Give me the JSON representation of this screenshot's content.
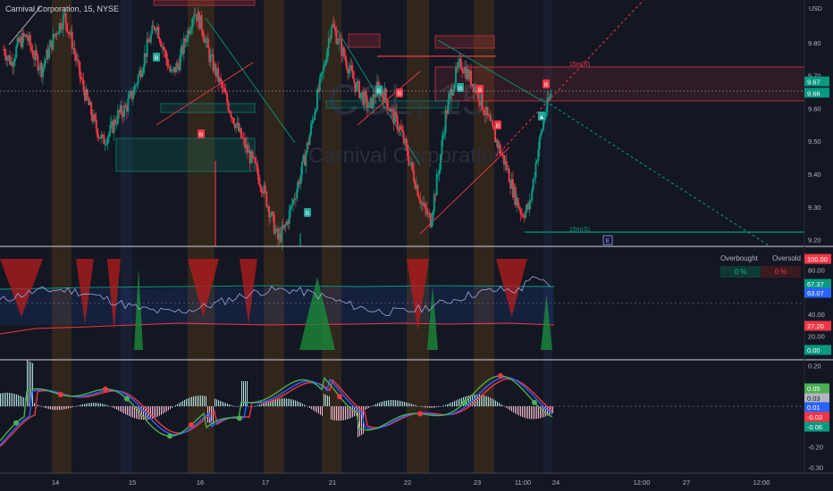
{
  "header": {
    "symbol_text": "Carnival Corporation, 15, NYSE"
  },
  "watermark": {
    "ticker": "CCL, 15",
    "name": "Carnival Corporation"
  },
  "price_axis": {
    "currency": "USD",
    "ticks": [
      "9.80",
      "9.70",
      "9.60",
      "9.50",
      "9.40",
      "9.30",
      "9.20"
    ],
    "tick_values": [
      9.8,
      9.7,
      9.6,
      9.5,
      9.4,
      9.3,
      9.2
    ],
    "tag_high": "9.67",
    "tag_high_value": 9.67,
    "tag_low": "9.66",
    "tag_low_value": 9.66
  },
  "time_axis": {
    "labels": [
      "14",
      "15",
      "16",
      "17",
      "21",
      "22",
      "23",
      "11:00",
      "24",
      "12:00",
      "27",
      "12:00"
    ]
  },
  "zones": {
    "resistance_label": "15m(R)",
    "support_label": "15m(S)",
    "e_marker": "E"
  },
  "signal_labels": {
    "buy": "B",
    "sell": "B",
    "up": "▲"
  },
  "rsi_panel": {
    "ticks": [
      "80.00",
      "60.00",
      "40.00",
      "20.00"
    ],
    "tick_values": [
      80,
      60,
      40,
      20
    ],
    "tags": [
      {
        "text": "100.00",
        "value": 100,
        "color": "#f23645"
      },
      {
        "text": "67.37",
        "value": 67.37,
        "color": "#089981"
      },
      {
        "text": "63.07",
        "value": 63.07,
        "color": "#2962ff"
      },
      {
        "text": "27.20",
        "value": 27.2,
        "color": "#f23645"
      },
      {
        "text": "0.00",
        "value": 0,
        "color": "#089981"
      }
    ],
    "overbought_label": "Overbought",
    "oversold_label": "Oversold",
    "overbought_value": "0 %",
    "oversold_value": "0 %"
  },
  "macd_panel": {
    "ticks": [
      "0.20",
      "-0.20",
      "-0.30"
    ],
    "tick_values": [
      0.2,
      -0.2,
      -0.3
    ],
    "tags": [
      {
        "text": "0.05",
        "value": 0.05,
        "color": "#4caf50"
      },
      {
        "text": "0.03",
        "value": 0.03,
        "color": "#b2b5be"
      },
      {
        "text": "0.01",
        "value": 0.01,
        "color": "#2962ff"
      },
      {
        "text": "-0.03",
        "value": -0.03,
        "color": "#f23645"
      },
      {
        "text": "-0.06",
        "value": -0.06,
        "color": "#089981"
      }
    ]
  },
  "colors": {
    "bg": "#131722",
    "up": "#089981",
    "down": "#f23645",
    "macd_line": "#4caf50",
    "signal_line": "#2962ff",
    "slow_line": "#f23645",
    "session_orange": "#3a2b1c",
    "session_blue": "#1a2238"
  },
  "chart_data": {
    "type": "candlestick",
    "title": "Carnival Corporation, 15, NYSE",
    "ylim": [
      9.18,
      9.93
    ],
    "close_path": [
      9.78,
      9.74,
      9.8,
      9.82,
      9.76,
      9.72,
      9.78,
      9.84,
      9.88,
      9.8,
      9.7,
      9.62,
      9.55,
      9.5,
      9.53,
      9.58,
      9.6,
      9.65,
      9.72,
      9.8,
      9.86,
      9.78,
      9.7,
      9.74,
      9.82,
      9.9,
      9.85,
      9.76,
      9.7,
      9.64,
      9.58,
      9.52,
      9.47,
      9.42,
      9.36,
      9.28,
      9.2,
      9.24,
      9.32,
      9.4,
      9.5,
      9.62,
      9.72,
      9.86,
      9.8,
      9.74,
      9.68,
      9.64,
      9.6,
      9.66,
      9.64,
      9.58,
      9.54,
      9.46,
      9.38,
      9.3,
      9.26,
      9.4,
      9.58,
      9.68,
      9.74,
      9.7,
      9.66,
      9.6,
      9.54,
      9.48,
      9.42,
      9.34,
      9.28,
      9.3,
      9.46,
      9.58,
      9.66
    ]
  }
}
